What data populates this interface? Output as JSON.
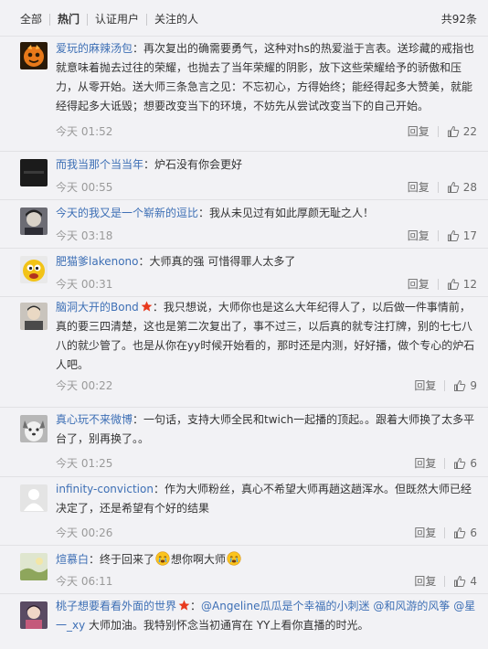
{
  "filter_bar": {
    "tabs": [
      "全部",
      "热门",
      "认证用户",
      "关注的人"
    ],
    "active_tab": "热门",
    "total": "共92条"
  },
  "comments": [
    {
      "user": "爱玩的麻辣汤包",
      "text": "：再次复出的确需要勇气，这种对hs的热爱溢于言表。送珍藏的戒指也就意味着抛去过往的荣耀，也抛去了当年荣耀的阴影，放下这些荣耀给予的骄傲和压力，从零开始。送大师三条急言之见：不忘初心，方得始终；能经得起多大赞美，就能经得起多大诋毁；想要改变当下的环境，不妨先从尝试改变当下的自己开始。",
      "time": "今天 01:52",
      "reply": "回复",
      "likes": "22"
    },
    {
      "user": "而我当那个当当年",
      "text": "：炉石没有你会更好",
      "time": "今天 00:55",
      "reply": "回复",
      "likes": "28"
    },
    {
      "user": "今天的我又是一个崭新的逗比",
      "text": "：我从未见过有如此厚颜无耻之人！",
      "time": "今天 03:18",
      "reply": "回复",
      "likes": "17"
    },
    {
      "user": "肥猫爹lakenono",
      "text": "：大师真的强 可惜得罪人太多了",
      "time": "今天 00:31",
      "reply": "回复",
      "likes": "12"
    },
    {
      "user": "脑洞大开的Bond",
      "text": "：我只想说，大师你也是这么大年纪得人了，以后做一件事情前，真的要三四清楚，这也是第二次复出了，事不过三，以后真的就专注打牌，别的七七八八的就少管了。也是从你在yy时候开始看的，那时还是内测，好好播，做个专心的炉石人吧。",
      "time": "今天 00:22",
      "reply": "回复",
      "likes": "9"
    },
    {
      "user": "真心玩不来微博",
      "text": "：一句话，支持大师全民和twich一起播的顶起。。跟着大师换了太多平台了，别再换了。。",
      "time": "今天 01:25",
      "reply": "回复",
      "likes": "6"
    },
    {
      "user": "infinity-conviction",
      "text": "：作为大师粉丝，真心不希望大师再趟这趟浑水。但既然大师已经决定了，还是希望有个好的结果",
      "time": "今天 00:26",
      "reply": "回复",
      "likes": "6"
    },
    {
      "user": "煊慕白",
      "text_1": "：终于回来了",
      "text_2": "想你啊大师",
      "time": "今天 06:11",
      "reply": "回复",
      "likes": "4"
    },
    {
      "user": "桃子想要看看外面的世界",
      "text_1": "：",
      "mention_1": "@Angeline瓜瓜是个幸福的小刺迷",
      "mention_2": "@和风游的风筝",
      "mention_3": "@星一_xy",
      "text_2": " 大师加油。我特别怀念当初通宵在 YY上看你直播的时光。"
    }
  ],
  "icons": {
    "like": "thumbs-up-icon",
    "verified": "red-star-icon",
    "emoji": "crying-face-icon"
  },
  "colors": {
    "link": "#3d6fb5",
    "meta": "#9a9a9a",
    "background": "#f2f2f5",
    "star": "#e8391d"
  }
}
